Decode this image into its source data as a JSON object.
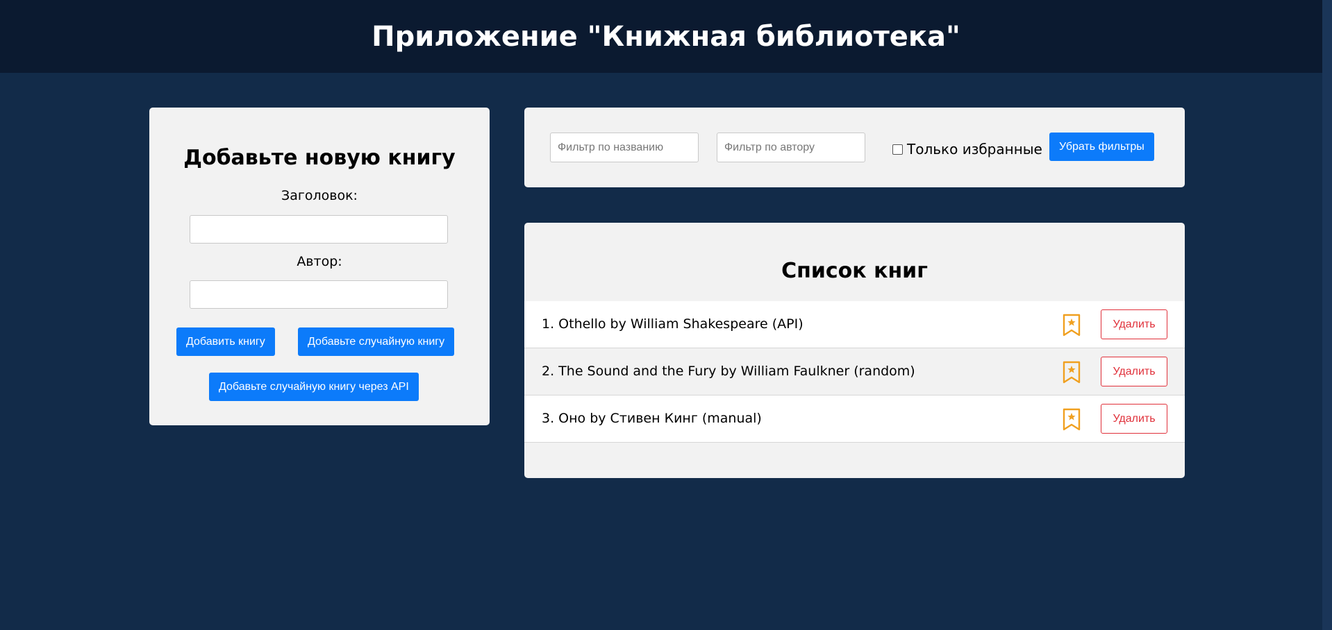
{
  "header": {
    "title": "Приложение \"Книжная библиотека\""
  },
  "add_form": {
    "heading": "Добавьте новую книгу",
    "title_label": "Заголовок:",
    "title_value": "",
    "author_label": "Автор:",
    "author_value": "",
    "add_button": "Добавить книгу",
    "add_random_button": "Добавьте случайную книгу",
    "add_api_button": "Добавьте случайную книгу через API"
  },
  "filters": {
    "title_placeholder": "Фильтр по названию",
    "author_placeholder": "Фильтр по автору",
    "favorites_label": "Только избранные",
    "favorites_checked": false,
    "clear_button": "Убрать фильтры"
  },
  "book_list": {
    "heading": "Список книг",
    "items": [
      {
        "text": "1. Othello by William Shakespeare (API)",
        "delete_label": "Удалить",
        "bookmark_icon": "bookmark-star-icon"
      },
      {
        "text": "2. The Sound and the Fury by William Faulkner (random)",
        "delete_label": "Удалить",
        "bookmark_icon": "bookmark-star-icon"
      },
      {
        "text": "3. Оно by Стивен Кинг (manual)",
        "delete_label": "Удалить",
        "bookmark_icon": "bookmark-star-icon"
      }
    ]
  },
  "colors": {
    "background": "#122b49",
    "header": "#0b1a30",
    "panel": "#f2f2f2",
    "primary_button": "#0c7bfa",
    "danger": "#e0303a",
    "bookmark": "#f0a020"
  }
}
